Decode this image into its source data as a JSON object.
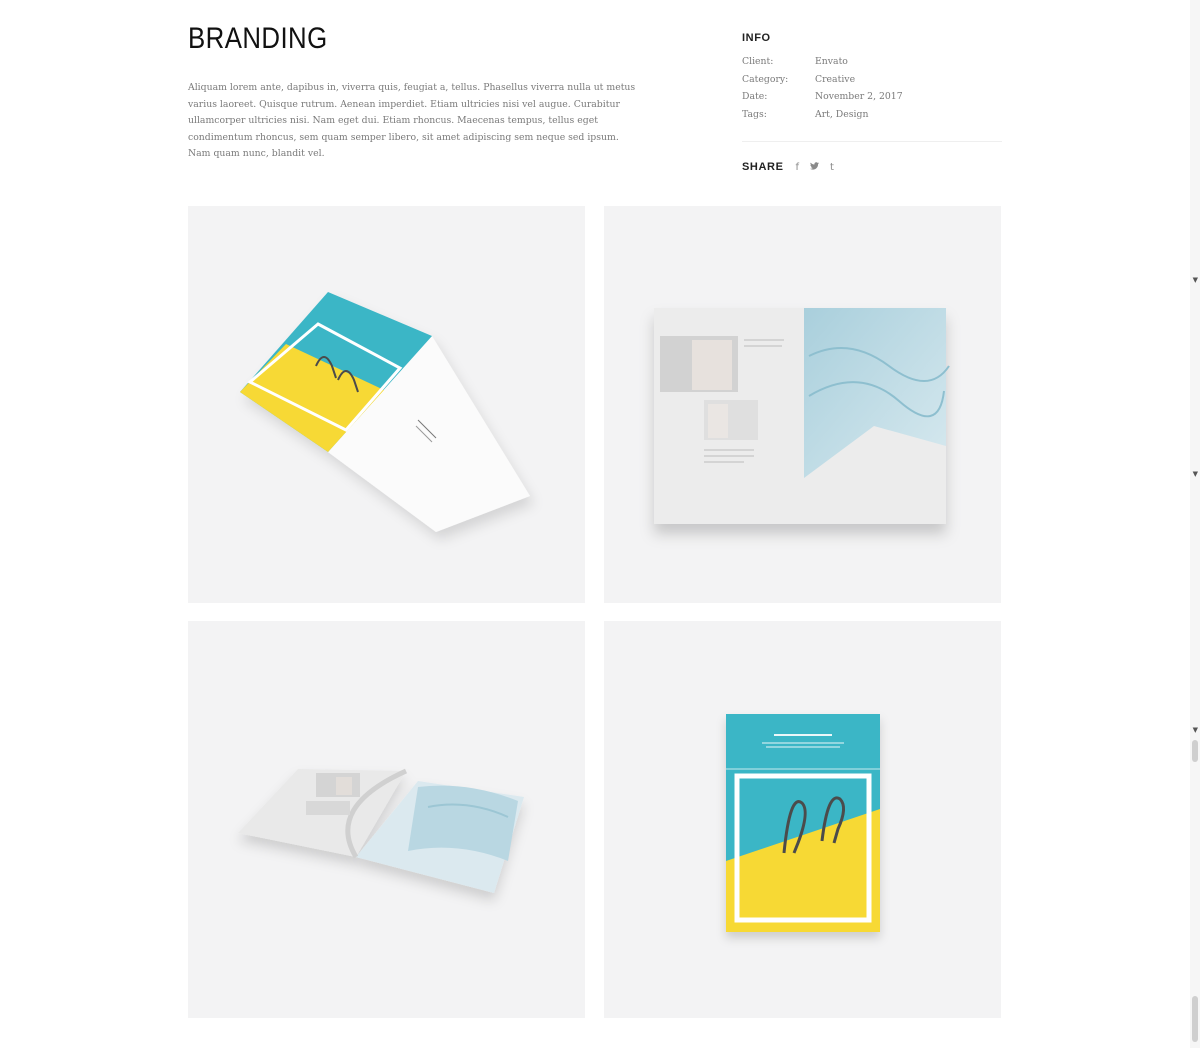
{
  "project": {
    "title": "BRANDING",
    "description": "Aliquam lorem ante, dapibus in, viverra quis, feugiat a, tellus. Phasellus viverra nulla ut metus varius laoreet. Quisque rutrum. Aenean imperdiet. Etiam ultricies nisi vel augue. Curabitur ullamcorper ultricies nisi. Nam eget dui. Etiam rhoncus. Maecenas tempus, tellus eget condimentum rhoncus, sem quam semper libero, sit amet adipiscing sem neque sed ipsum. Nam quam nunc, blandit vel."
  },
  "info": {
    "heading": "INFO",
    "rows": [
      {
        "label": "Client:",
        "value": "Envato"
      },
      {
        "label": "Category:",
        "value": "Creative"
      },
      {
        "label": "Date:",
        "value": "November 2, 2017"
      },
      {
        "label": "Tags:",
        "value": "Art, Design"
      }
    ]
  },
  "share": {
    "label": "SHARE",
    "icons": [
      {
        "name": "facebook-icon",
        "glyph": "f"
      },
      {
        "name": "twitter-icon",
        "glyph": "🐦"
      },
      {
        "name": "tumblr-icon",
        "glyph": "t"
      }
    ]
  },
  "gallery": [
    {
      "name": "open-brochure-cover-and-page"
    },
    {
      "name": "open-magazine-spread-fabric"
    },
    {
      "name": "open-magazine-perspective"
    },
    {
      "name": "brochure-cover-front"
    }
  ],
  "colors": {
    "turquoise": "#3bb6c6",
    "yellow": "#f7d934",
    "tile_background": "#f3f3f4"
  }
}
